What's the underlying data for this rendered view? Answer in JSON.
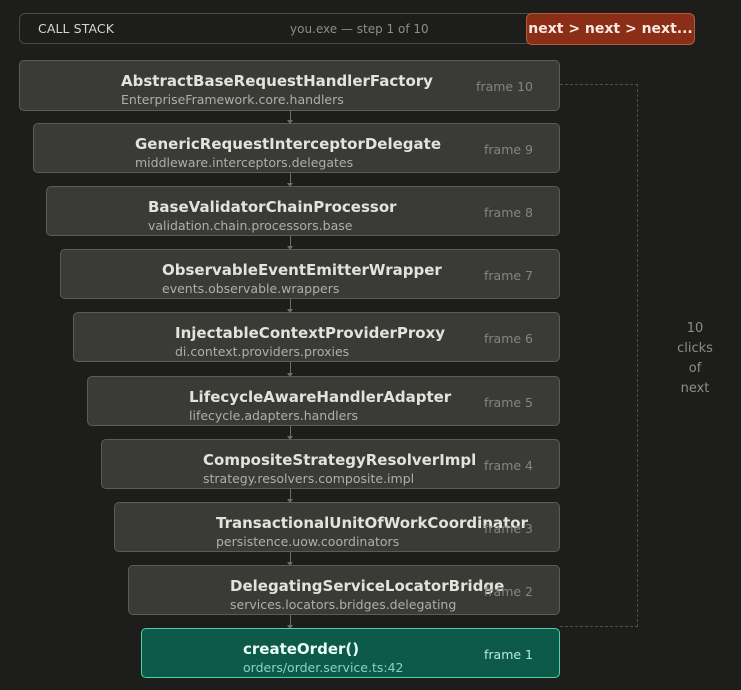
{
  "header": {
    "title": "CALL STACK",
    "step": "you.exe — step 1 of 10",
    "next_label": "next > next > next..."
  },
  "frames": [
    {
      "name": "AbstractBaseRequestHandlerFactory",
      "path": "EnterpriseFramework.core.handlers",
      "label": "frame 10"
    },
    {
      "name": "GenericRequestInterceptorDelegate",
      "path": "middleware.interceptors.delegates",
      "label": "frame 9"
    },
    {
      "name": "BaseValidatorChainProcessor",
      "path": "validation.chain.processors.base",
      "label": "frame 8"
    },
    {
      "name": "ObservableEventEmitterWrapper",
      "path": "events.observable.wrappers",
      "label": "frame 7"
    },
    {
      "name": "InjectableContextProviderProxy",
      "path": "di.context.providers.proxies",
      "label": "frame 6"
    },
    {
      "name": "LifecycleAwareHandlerAdapter",
      "path": "lifecycle.adapters.handlers",
      "label": "frame 5"
    },
    {
      "name": "CompositeStrategyResolverImpl",
      "path": "strategy.resolvers.composite.impl",
      "label": "frame 4"
    },
    {
      "name": "TransactionalUnitOfWorkCoordinator",
      "path": "persistence.uow.coordinators",
      "label": "frame 3"
    },
    {
      "name": "DelegatingServiceLocatorBridge",
      "path": "services.locators.bridges.delegating",
      "label": "frame 2"
    },
    {
      "name": "createOrder()",
      "path": "orders/order.service.ts:42",
      "label": "frame 1",
      "active": true
    }
  ],
  "annotation": {
    "lines": [
      "10",
      "clicks",
      "of",
      "next"
    ]
  },
  "colors": {
    "background": "#1d1d1b",
    "frame": "#3a3a37",
    "active_frame": "#0e5a4a",
    "active_border": "#4cd4a6",
    "next_button": "#8a2e18"
  }
}
